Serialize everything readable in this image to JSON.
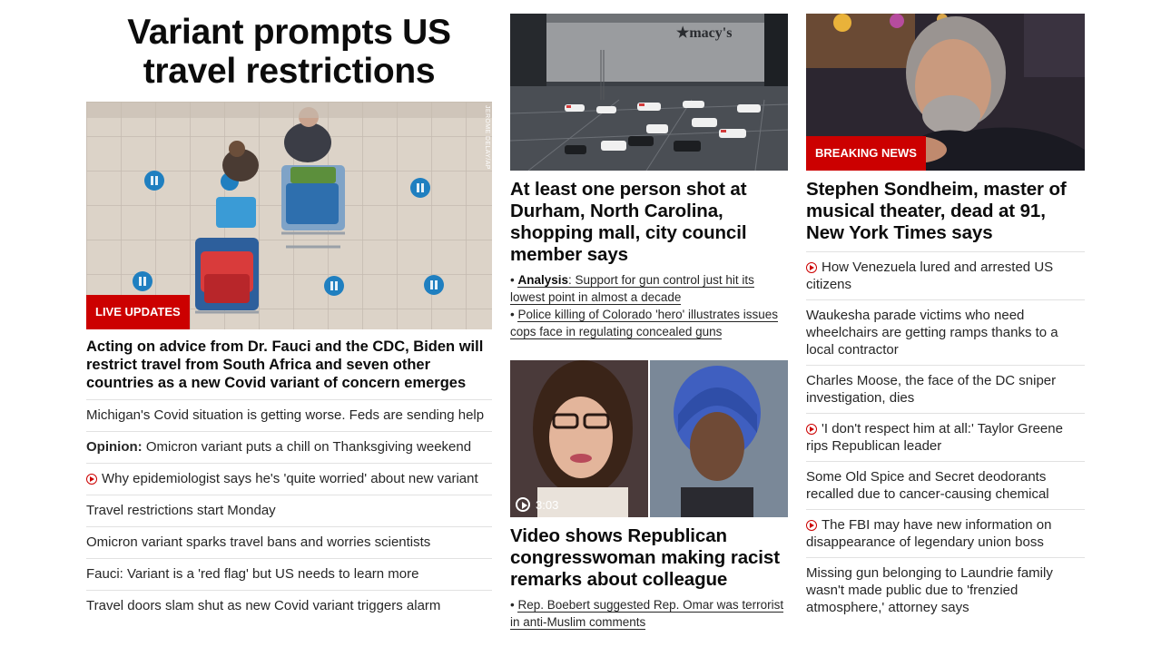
{
  "col1": {
    "headline": "Variant prompts US travel restrictions",
    "image_badge": "LIVE UPDATES",
    "image_credit": "JEROME DELAY/AP",
    "lead": "Acting on advice from Dr. Fauci and the CDC, Biden will restrict travel from South Africa and seven other countries as a new Covid variant of concern emerges",
    "items": [
      {
        "text": "Michigan's Covid situation is getting worse. Feds are sending help"
      },
      {
        "prefix": "Opinion:",
        "text": " Omicron variant puts a chill on Thanksgiving weekend"
      },
      {
        "video": true,
        "text": "Why epidemiologist says he's 'quite worried' about new variant"
      },
      {
        "text": "Travel restrictions start Monday"
      },
      {
        "text": "Omicron variant sparks travel bans and worries scientists"
      },
      {
        "text": "Fauci: Variant is a 'red flag' but US needs to learn more"
      },
      {
        "text": "Travel doors slam shut as new Covid variant triggers alarm"
      }
    ]
  },
  "col2": {
    "story1": {
      "image_sign": "macy's",
      "title": "At least one person shot at Durham, North Carolina, shopping mall, city council member says",
      "sub1_bold": "Analysis",
      "sub1_text": ": Support for gun control just hit its lowest point in almost a decade",
      "sub2_text": "Police killing of Colorado 'hero' illustrates issues cops face in regulating concealed guns"
    },
    "story2": {
      "duration": "3:03",
      "title": "Video shows Republican congresswoman making racist remarks about colleague",
      "sub_text": "Rep. Boebert suggested Rep. Omar was terrorist in anti-Muslim comments"
    }
  },
  "col3": {
    "image_badge": "BREAKING NEWS",
    "title": "Stephen Sondheim, master of musical theater, dead at 91, New York Times says",
    "items": [
      {
        "video": true,
        "text": "How Venezuela lured and arrested US citizens"
      },
      {
        "text": "Waukesha parade victims who need wheelchairs are getting ramps thanks to a local contractor"
      },
      {
        "text": "Charles Moose, the face of the DC sniper investigation, dies"
      },
      {
        "video": true,
        "text": "'I don't respect him at all:' Taylor Greene rips Republican leader"
      },
      {
        "text": "Some Old Spice and Secret deodorants recalled due to cancer-causing chemical"
      },
      {
        "video": true,
        "text": "The FBI may have new information on disappearance of legendary union boss"
      },
      {
        "text": "Missing gun belonging to Laundrie family wasn't made public due to 'frenzied atmosphere,' attorney says"
      }
    ]
  },
  "colors": {
    "accent": "#cc0000",
    "divider": "#e1e1e1",
    "text": "#0c0c0c"
  }
}
